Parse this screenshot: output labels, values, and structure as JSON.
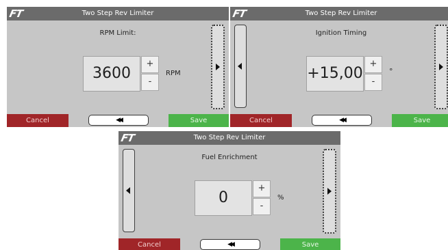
{
  "app": {
    "logo_text": "FT",
    "title": "Two Step Rev Limiter"
  },
  "screens": [
    {
      "id": "rpm-limit",
      "label": "RPM Limit:",
      "value": "3600",
      "unit": "RPM",
      "plus_label": "+",
      "minus_label": "-",
      "has_prev": false,
      "has_next": true
    },
    {
      "id": "ignition-timing",
      "label": "Ignition Timing",
      "value": "+15,00",
      "unit": "°",
      "plus_label": "+",
      "minus_label": "-",
      "has_prev": true,
      "has_next": true
    },
    {
      "id": "fuel-enrichment",
      "label": "Fuel Enrichment",
      "value": "0",
      "unit": "%",
      "plus_label": "+",
      "minus_label": "-",
      "has_prev": true,
      "has_next": true
    }
  ],
  "footer": {
    "cancel_label": "Cancel",
    "back_label": "◀◀",
    "save_label": "Save"
  },
  "icons": {
    "prev": "triangle-left-icon",
    "next": "triangle-right-icon",
    "back": "double-left-arrow-icon"
  },
  "colors": {
    "screen_bg": "#c6c6c6",
    "header_bg": "#6b6b6b",
    "cancel_bg": "#a02528",
    "save_bg": "#4cb44a",
    "value_bg": "#e3e3e3"
  }
}
